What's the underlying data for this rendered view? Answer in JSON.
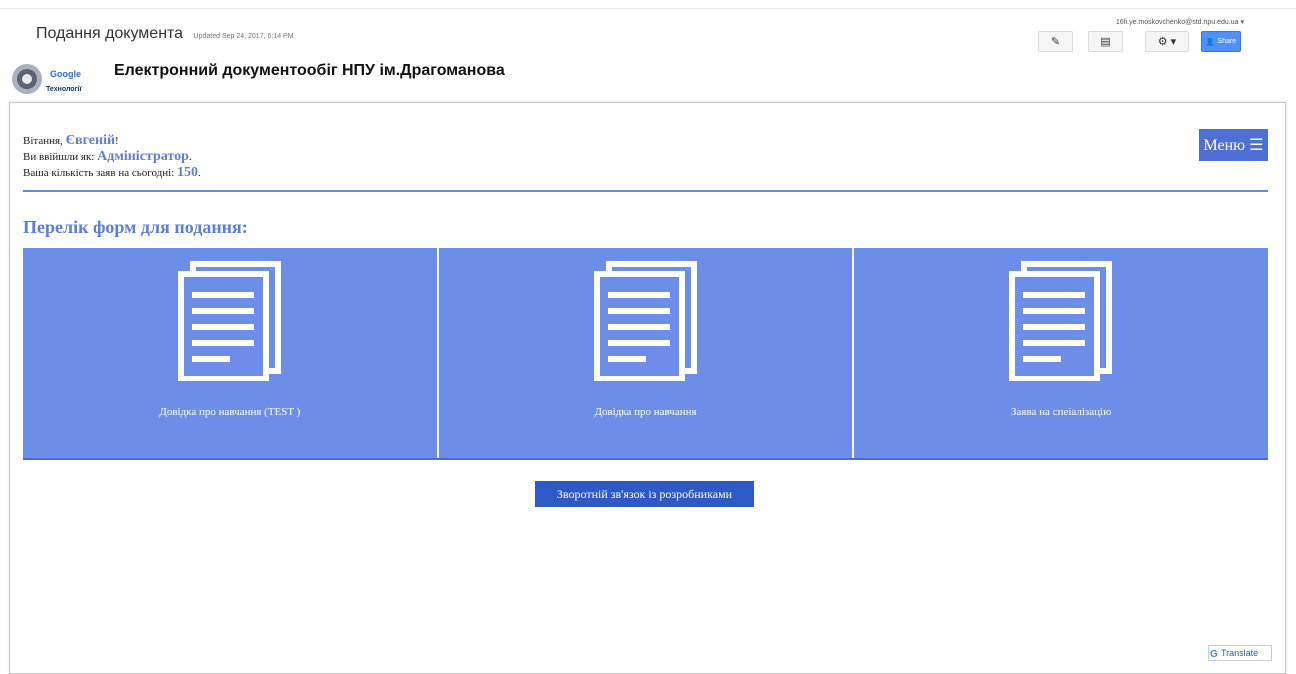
{
  "header": {
    "title": "Подання документа",
    "updated": "Updated Sep 24, 2017, 6:14 PM",
    "user": "16fi.ye.moskovchenko@std.npu.edu.ua",
    "share_label": "Share"
  },
  "site": {
    "title": "Електронний документообіг НПУ ім.Драгоманова",
    "logo_text": "Google",
    "logo_sub": "Технології"
  },
  "greeting": {
    "hello_prefix": "Вітання, ",
    "name": "Євгеній",
    "hello_suffix": "!",
    "role_prefix": "Ви ввійшли як: ",
    "role": "Адміністратор",
    "role_suffix": ".",
    "count_prefix": "Ваша кількість заяв на сьогодні: ",
    "count": "150",
    "count_suffix": "."
  },
  "menu_label": "Меню ☰",
  "forms_heading": "Перелік форм для подання:",
  "forms": [
    {
      "label": "Довідка про навчання (TEST )"
    },
    {
      "label": "Довідка про навчання"
    },
    {
      "label": "Заява на спеіалізацію"
    }
  ],
  "feedback_button": "Зворотній зв'язок із розробниками",
  "translate": "Translate",
  "icons": [
    "pencil-icon",
    "page-icon",
    "gear-icon",
    "person-icon",
    "document-icon",
    "google-g-icon"
  ],
  "colors": {
    "accent": "#4e6fd6",
    "card": "#6d8ee8",
    "heading": "#5a7edb"
  }
}
